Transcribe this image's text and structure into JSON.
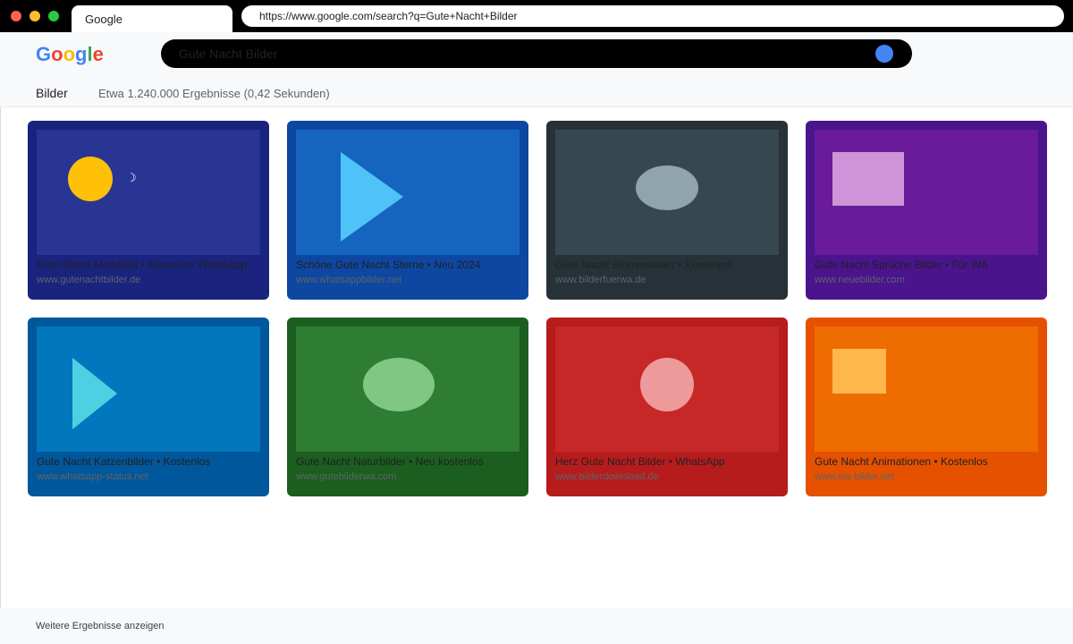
{
  "browser": {
    "tab_title": "Google",
    "url": "https://www.google.com/search?q=Gute+Nacht+Bilder",
    "window_controls": [
      "red-dot",
      "yellow-dot",
      "green-dot"
    ]
  },
  "logo": {
    "letters": [
      {
        "char": "G",
        "color": "#4285f4"
      },
      {
        "char": "o",
        "color": "#ea4335"
      },
      {
        "char": "o",
        "color": "#fbbc05"
      },
      {
        "char": "g",
        "color": "#4285f4"
      },
      {
        "char": "l",
        "color": "#34a853"
      },
      {
        "char": "e",
        "color": "#ea4335"
      }
    ]
  },
  "search": {
    "value": "Gute Nacht Bilder",
    "button_icon": "search-circle-icon",
    "button_color": "#4285f4"
  },
  "results": {
    "filter_label": "Bilder",
    "stats": "Etwa 1.240.000 Ergebnisse (0,42 Sekunden)"
  },
  "cards": [
    {
      "title": "Gute Nacht Mondbild • Kostenlos WhatsApp",
      "source": "www.gutenachtbilder.de",
      "bg": "#1a237e",
      "thumb_bg": "#283593",
      "shape": "circle-moon",
      "shape_color": "#ffc107",
      "icon": "moon-icon"
    },
    {
      "title": "Schöne Gute Nacht Sterne • Neu 2024",
      "source": "www.whatsappbilder.net",
      "bg": "#0d47a1",
      "thumb_bg": "#1565c0",
      "shape": "triangle",
      "shape_color": "#4fc3f7",
      "icon": "play-icon"
    },
    {
      "title": "Gute Nacht Blumenbilder • Kostenlos",
      "source": "www.bilderfuerwa.de",
      "bg": "#263238",
      "thumb_bg": "#37474f",
      "shape": "ellipse",
      "shape_color": "#90a4ae",
      "icon": "flower-icon"
    },
    {
      "title": "Gute Nacht Sprüche Bilder • Für WA",
      "source": "www.neuebilder.com",
      "bg": "#4a148c",
      "thumb_bg": "#6a1b9a",
      "shape": "rectangle",
      "shape_color": "#ce93d8",
      "icon": "quote-icon"
    },
    {
      "title": "Gute Nacht Katzenbilder • Kostenlos",
      "source": "www.whatsapp-status.net",
      "bg": "#01579b",
      "thumb_bg": "#0277bd",
      "shape": "triangle-small",
      "shape_color": "#4dd0e1",
      "icon": "play-icon"
    },
    {
      "title": "Gute Nacht Naturbilder • Neu kostenlos",
      "source": "www.gutebilderwa.com",
      "bg": "#1b5e20",
      "thumb_bg": "#2e7d32",
      "shape": "ellipse",
      "shape_color": "#81c784",
      "icon": "nature-icon"
    },
    {
      "title": "Herz Gute Nacht Bilder • WhatsApp",
      "source": "www.bilderdownload.de",
      "bg": "#b71c1c",
      "thumb_bg": "#c62828",
      "shape": "circle",
      "shape_color": "#ef9a9a",
      "icon": "heart-icon"
    },
    {
      "title": "Gute Nacht Animationen • Kostenlos",
      "source": "www.wa-bilder.net",
      "bg": "#e65100",
      "thumb_bg": "#ef6c00",
      "shape": "square",
      "shape_color": "#ffb74d",
      "icon": "animation-icon"
    }
  ],
  "footer": {
    "more_label": "Weitere Ergebnisse anzeigen"
  }
}
